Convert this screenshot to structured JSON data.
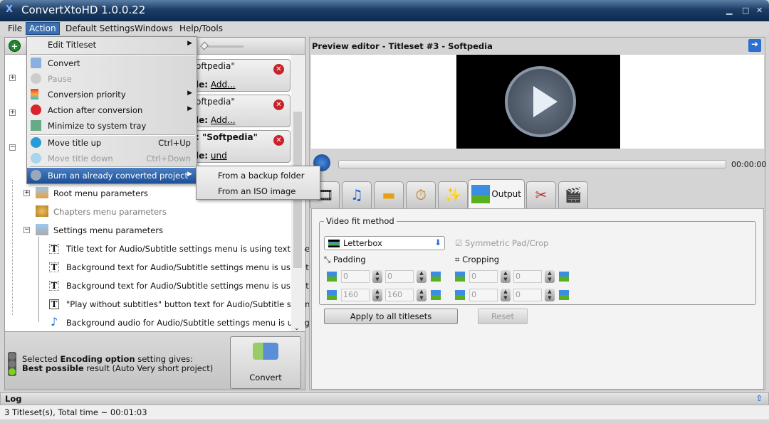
{
  "window": {
    "title": "ConvertXtoHD 1.0.0.22",
    "logo": "X"
  },
  "menubar": [
    "File",
    "Action",
    "Default Settings",
    "Windows",
    "Help/Tools"
  ],
  "action_menu": {
    "edit_titleset": "Edit Titleset",
    "convert": "Convert",
    "pause": "Pause",
    "conversion_priority": "Conversion priority",
    "action_after": "Action after conversion",
    "minimize": "Minimize to system tray",
    "move_up": "Move title up",
    "move_up_sc": "Ctrl+Up",
    "move_down": "Move title down",
    "move_down_sc": "Ctrl+Down",
    "burn": "Burn an already converted project"
  },
  "burn_submenu": [
    "From a backup folder",
    "From an ISO image"
  ],
  "titlesets": [
    {
      "title": "oftpedia\"",
      "sub_label": "le:",
      "sub_value": "Add..."
    },
    {
      "title": "oftpedia\"",
      "sub_label": "le:",
      "sub_value": "Add..."
    },
    {
      "title": ": \"Softpedia\"",
      "sub_label": "le:",
      "sub_value": "und"
    }
  ],
  "tree": {
    "root": "Root menu parameters",
    "chapters": "Chapters menu parameters",
    "settings": "Settings menu parameters",
    "children": [
      "Title text for Audio/Subtitle settings menu is using text: \"Settin...",
      "Background text for Audio/Subtitle settings menu is using text:...",
      "Background text for Audio/Subtitle settings menu is using text:...",
      "\"Play without subtitles\" button text for Audio/Subtitle settings ...",
      "Background audio for Audio/Subtitle settings menu is using def..."
    ]
  },
  "info": {
    "l1a": "Selected ",
    "l1b": "Encoding option",
    "l1c": " setting gives:",
    "l2a": "Best possible",
    "l2b": " result (Auto Very short project)"
  },
  "convert_button": "Convert",
  "preview": {
    "title": "Preview editor - Titleset #3 - Softpedia",
    "time": "00:00:00"
  },
  "tabs": {
    "active": "Output"
  },
  "output": {
    "legend": "Video fit method",
    "fit": "Letterbox",
    "symmetric": "Symmetric Pad/Crop",
    "padding": "Padding",
    "cropping": "Cropping",
    "pad": [
      "0",
      "0",
      "160",
      "160"
    ],
    "crop": [
      "0",
      "0",
      "0",
      "0"
    ],
    "apply": "Apply to all titlesets",
    "reset": "Reset"
  },
  "log": {
    "label": "Log",
    "status": "3 Titleset(s), Total time ~ 00:01:03"
  }
}
